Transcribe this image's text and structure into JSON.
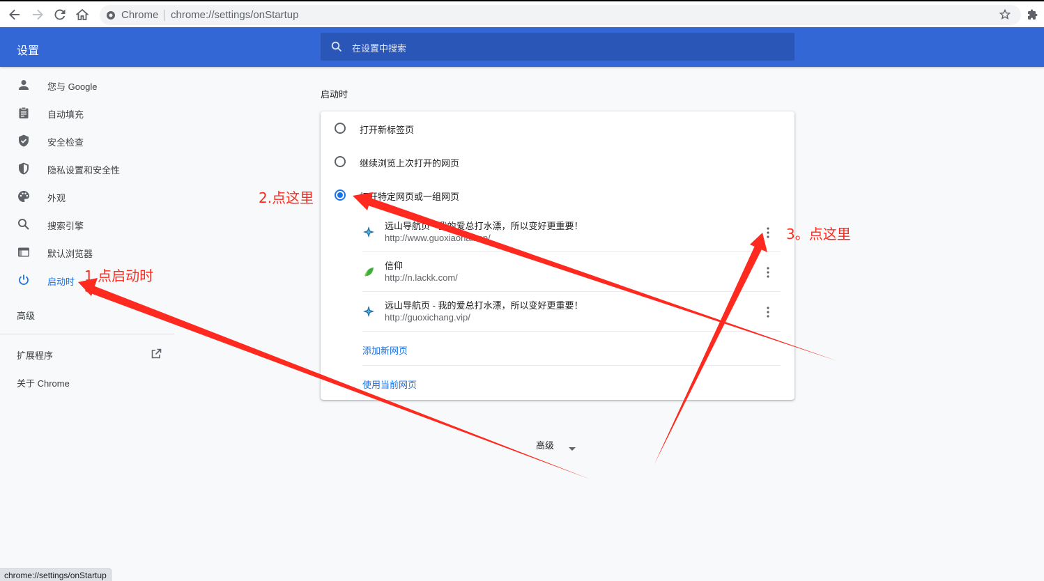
{
  "browser": {
    "site_label": "Chrome",
    "url": "chrome://settings/onStartup",
    "status_url": "chrome://settings/onStartup",
    "icons": [
      "back-icon",
      "forward-icon",
      "reload-icon",
      "home-icon",
      "site-info-icon",
      "star-icon",
      "extensions-icon"
    ]
  },
  "header": {
    "title": "设置",
    "search_placeholder": "在设置中搜索"
  },
  "sidebar": {
    "items": [
      {
        "label": "您与 Google",
        "icon": "person-icon"
      },
      {
        "label": "自动填充",
        "icon": "clipboard-icon"
      },
      {
        "label": "安全检查",
        "icon": "shield-check-icon"
      },
      {
        "label": "隐私设置和安全性",
        "icon": "shield-icon"
      },
      {
        "label": "外观",
        "icon": "palette-icon"
      },
      {
        "label": "搜索引擎",
        "icon": "search-icon"
      },
      {
        "label": "默认浏览器",
        "icon": "browser-icon"
      },
      {
        "label": "启动时",
        "icon": "power-icon",
        "active": true
      }
    ],
    "advanced": "高级",
    "extensions": "扩展程序",
    "about": "关于 Chrome"
  },
  "main": {
    "section_title": "启动时",
    "options": [
      {
        "label": "打开新标签页",
        "selected": false
      },
      {
        "label": "继续浏览上次打开的网页",
        "selected": false
      },
      {
        "label": "打开特定网页或一组网页",
        "selected": true
      }
    ],
    "pages": [
      {
        "title": "远山导航页 - 我的爱总打水漂，所以变好更重要！",
        "url": "http://www.guoxiaohai.top/"
      },
      {
        "title": "信仰",
        "url": "http://n.lackk.com/"
      },
      {
        "title": "远山导航页 - 我的爱总打水漂，所以变好更重要！",
        "url": "http://guoxichang.vip/"
      }
    ],
    "add_page": "添加新网页",
    "use_current": "使用当前网页",
    "advanced": "高级"
  },
  "annotations": {
    "step1": "1.点启动时",
    "step2": "2.点这里",
    "step3": "3。点这里",
    "color": "#ff2a1f"
  }
}
